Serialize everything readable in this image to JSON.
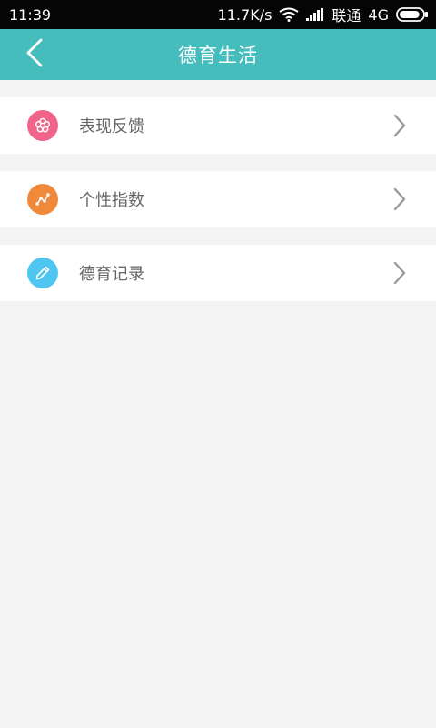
{
  "status_bar": {
    "time": "11:39",
    "network_speed": "11.7K/s",
    "carrier": "联通",
    "network_type": "4G",
    "battery_level": 0.9
  },
  "header": {
    "title": "德育生活",
    "back_icon": "chevron-left-icon",
    "background_color": "#45bdbd"
  },
  "menu": {
    "items": [
      {
        "label": "表现反馈",
        "icon": "flower-icon",
        "icon_color": "#f0648a"
      },
      {
        "label": "个性指数",
        "icon": "trend-line-icon",
        "icon_color": "#f0893a"
      },
      {
        "label": "德育记录",
        "icon": "pencil-icon",
        "icon_color": "#4ec6f1"
      }
    ],
    "chevron_icon": "chevron-right-icon"
  }
}
